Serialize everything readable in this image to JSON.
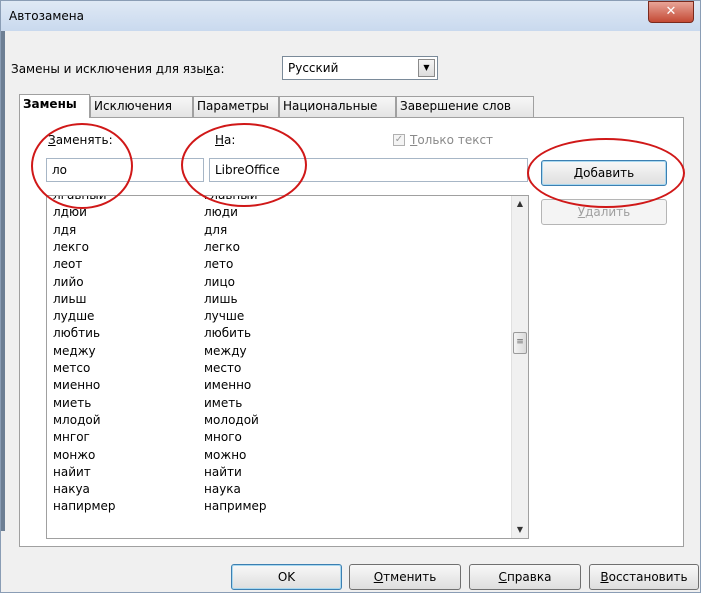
{
  "window": {
    "title": "Автозамена",
    "close_icon": "close-icon"
  },
  "language": {
    "label": "Замены и исключения для языка:",
    "label_ul_index": 27,
    "selected": "Русский"
  },
  "tabs": [
    {
      "label": "Замены",
      "active": true
    },
    {
      "label": "Исключения",
      "active": false
    },
    {
      "label": "Параметры",
      "active": false
    },
    {
      "label": "Национальные",
      "active": false
    },
    {
      "label": "Завершение слов",
      "active": false
    }
  ],
  "replace": {
    "label_ul": "З",
    "label_rest": "аменять:",
    "value": "ло"
  },
  "with": {
    "label_ul": "Н",
    "label_rest": "а:",
    "value": "LibreOffice"
  },
  "text_only": {
    "label_ul": "Т",
    "label_rest": "олько текст",
    "checked": true
  },
  "buttons": {
    "add": "Добавить",
    "delete_ul": "У",
    "delete_rest": "далить",
    "ok": "OK",
    "cancel_ul": "О",
    "cancel_rest": "тменить",
    "help_ul": "С",
    "help_rest": "правка",
    "reset_ul": "В",
    "reset_rest": "осстановить"
  },
  "list": {
    "rows": [
      {
        "from": "лгавный",
        "to": "главный"
      },
      {
        "from": "лдюи",
        "to": "люди"
      },
      {
        "from": "лдя",
        "to": "для"
      },
      {
        "from": "лекго",
        "to": "легко"
      },
      {
        "from": "леот",
        "to": "лето"
      },
      {
        "from": "лийо",
        "to": "лицо"
      },
      {
        "from": "лиьш",
        "to": "лишь"
      },
      {
        "from": "лудше",
        "to": "лучше"
      },
      {
        "from": "любтиь",
        "to": "любить"
      },
      {
        "from": "меджу",
        "to": "между"
      },
      {
        "from": "метсо",
        "to": "место"
      },
      {
        "from": "миенно",
        "to": "именно"
      },
      {
        "from": "миеть",
        "to": "иметь"
      },
      {
        "from": "млодой",
        "to": "молодой"
      },
      {
        "from": "мнгог",
        "to": "много"
      },
      {
        "from": "монжо",
        "to": "можно"
      },
      {
        "from": "найит",
        "to": "найти"
      },
      {
        "from": "накуа",
        "to": "наука"
      },
      {
        "from": "напирмер",
        "to": "например"
      }
    ]
  },
  "colors": {
    "annotation": "#d01818"
  }
}
